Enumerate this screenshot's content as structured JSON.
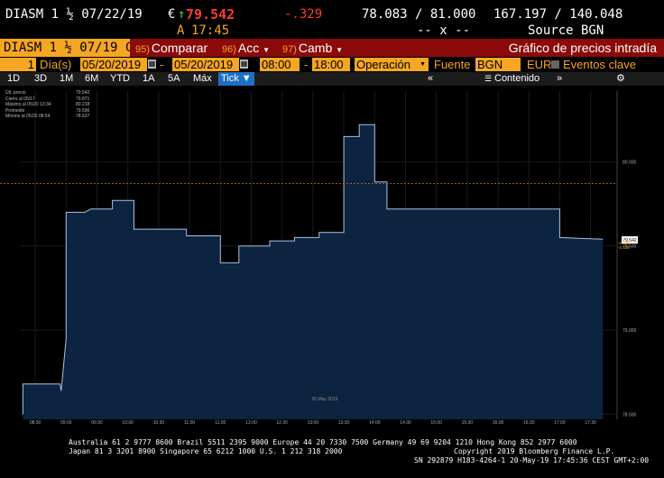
{
  "header": {
    "ticker": "DIASM 1 ½ 07/22/19",
    "currency_symbol": "€",
    "arrow": "↑",
    "last_price": "79.542",
    "change": "-.329",
    "bid_ask": "78.083 / 81.000",
    "size_pair": "167.197 / 140.048",
    "time_prefix": "A",
    "time": "17:45",
    "dashes": "-- x --",
    "source": "Source BGN"
  },
  "toolbar": {
    "ticker_short": "DIASM 1 ½ 07/19 C",
    "compare_num": "95)",
    "compare_label": "Comparar",
    "actions_num": "96)",
    "actions_label": "Acc",
    "change_num": "97)",
    "change_label": "Camb",
    "title": "Gráfico de precios intradía"
  },
  "controls": {
    "period_value": "1",
    "period_unit": "Día(s)",
    "date_start": "05/20/2019",
    "date_end": "05/20/2019",
    "time_start": "08:00",
    "time_sep": "-",
    "time_end": "18:00",
    "mode": "Operación",
    "source_label": "Fuente",
    "source_value": "BGN",
    "currency": "EUR",
    "key_events_label": "Eventos clave"
  },
  "tabs": {
    "items": [
      "1D",
      "3D",
      "1M",
      "6M",
      "YTD",
      "1A",
      "5A",
      "Máx"
    ],
    "active": "Tick ▼",
    "collapse": "«",
    "contents": "Contenido",
    "expand": "»"
  },
  "legend": {
    "rows": [
      {
        "label": "Últ. precio",
        "value": "79.542"
      },
      {
        "label": "Cierre al 05/17",
        "value": "79.871"
      },
      {
        "label": "Máximo al 05/20 13:34",
        "value": "80.218"
      },
      {
        "label": "Promedio",
        "value": "79.596"
      },
      {
        "label": "Mínimo al 05/20 08:54",
        "value": "78.637"
      }
    ]
  },
  "chart_data": {
    "type": "area",
    "x_label": "20 May 2019",
    "x_ticks": [
      "08:30",
      "09:00",
      "09:30",
      "10:00",
      "10:30",
      "11:00",
      "11:30",
      "12:00",
      "12:30",
      "13:00",
      "13:30",
      "14:00",
      "14:30",
      "15:00",
      "15:30",
      "16:00",
      "16:30",
      "17:00",
      "17:30"
    ],
    "y_ticks": [
      78.5,
      79.0,
      79.5,
      80.0
    ],
    "ylim": [
      78.47,
      80.42
    ],
    "xlim_hours": [
      8.25,
      17.9
    ],
    "prev_close": 79.871,
    "last_label": "79.542",
    "change_label1": "-0.329",
    "change_label2": "-0.415",
    "series": [
      {
        "x": [
          8.3,
          8.3,
          8.5,
          8.5,
          8.8,
          8.9,
          8.92,
          9.0,
          9.0,
          9.3,
          9.3,
          9.4,
          9.4,
          9.75,
          9.75,
          10.1,
          10.1,
          10.75,
          10.75,
          10.95,
          10.95,
          11.1,
          11.1,
          11.5,
          11.5,
          11.8,
          11.8,
          12.3,
          12.3,
          12.7,
          12.7,
          13.1,
          13.1,
          13.5,
          13.5,
          13.75,
          13.75,
          14.0,
          14.0,
          14.2,
          14.2,
          16.8,
          16.8,
          17.0,
          17.0,
          17.7
        ],
        "y": [
          78.5,
          78.68,
          78.68,
          78.68,
          78.68,
          78.68,
          78.64,
          78.95,
          79.7,
          79.7,
          79.7,
          79.72,
          79.72,
          79.72,
          79.77,
          79.77,
          79.6,
          79.6,
          79.6,
          79.6,
          79.56,
          79.56,
          79.56,
          79.56,
          79.4,
          79.4,
          79.5,
          79.5,
          79.53,
          79.53,
          79.55,
          79.55,
          79.58,
          79.58,
          80.15,
          80.15,
          80.22,
          80.22,
          79.88,
          79.88,
          79.72,
          79.72,
          79.72,
          79.72,
          79.55,
          79.54
        ]
      }
    ]
  },
  "footer": {
    "line1": "Australia 61 2 9777 8600 Brazil 5511 2395 9000 Europe 44 20 7330 7500 Germany 49 69 9204 1210 Hong Kong 852 2977 6000",
    "line2": "Japan 81 3 3201 8900       Singapore 65 6212 1000      U.S. 1 212 318 2000",
    "line3": "Copyright 2019 Bloomberg Finance L.P.",
    "line4": "SN 292879 H183-4264-1 20-May-19 17:45:36 CEST GMT+2:00"
  },
  "colors": {
    "accent": "#f5a623",
    "toolbar_red": "#8b0a0a",
    "area_fill": "#0d2440",
    "area_line": "#a8c4df",
    "prev_close_line": "#c87a2a",
    "active_tab": "#1f6fc4"
  }
}
